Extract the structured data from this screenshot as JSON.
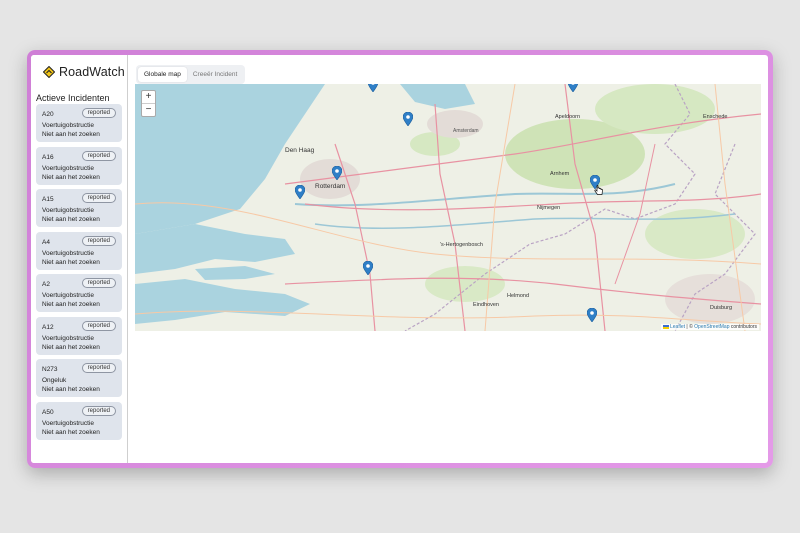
{
  "app": {
    "name": "RoadWatch"
  },
  "sidebar": {
    "title": "Actieve Incidenten",
    "incidents": [
      {
        "road": "A20",
        "badge": "reported",
        "type": "Voertuigobstructie",
        "status": "Niet aan het zoeken"
      },
      {
        "road": "A16",
        "badge": "reported",
        "type": "Voertuigobstructie",
        "status": "Niet aan het zoeken"
      },
      {
        "road": "A15",
        "badge": "reported",
        "type": "Voertuigobstructie",
        "status": "Niet aan het zoeken"
      },
      {
        "road": "A4",
        "badge": "reported",
        "type": "Voertuigobstructie",
        "status": "Niet aan het zoeken"
      },
      {
        "road": "A2",
        "badge": "reported",
        "type": "Voertuigobstructie",
        "status": "Niet aan het zoeken"
      },
      {
        "road": "A12",
        "badge": "reported",
        "type": "Voertuigobstructie",
        "status": "Niet aan het zoeken"
      },
      {
        "road": "N273",
        "badge": "reported",
        "type": "Ongeluk",
        "status": "Niet aan het zoeken"
      },
      {
        "road": "A50",
        "badge": "reported",
        "type": "Voertuigobstructie",
        "status": "Niet aan het zoeken"
      }
    ]
  },
  "tabs": {
    "global": "Globale map",
    "create": "Creeër Incident"
  },
  "map": {
    "zoom_in": "+",
    "zoom_out": "−",
    "attribution_leaflet": "Leaflet",
    "attribution_sep": " | © ",
    "attribution_osm": "OpenStreetMap",
    "attribution_tail": " contributors",
    "labels": {
      "den_haag": "Den Haag",
      "rotterdam": "Rotterdam",
      "amsterdam": "Amsterdam",
      "apeldoorn": "Apeldoorn",
      "enschede": "Enschede",
      "arnhem": "Arnhem",
      "nijmegen": "Nijmegen",
      "den_bosch": "'s-Hertogenbosch",
      "eindhoven": "Eindhoven",
      "helmond": "Helmond",
      "duisburg": "Duisburg"
    }
  },
  "colors": {
    "accent": "#e8b400",
    "pin": "#2f7fc7",
    "sea": "#aad3df",
    "land": "#eef0e6"
  }
}
